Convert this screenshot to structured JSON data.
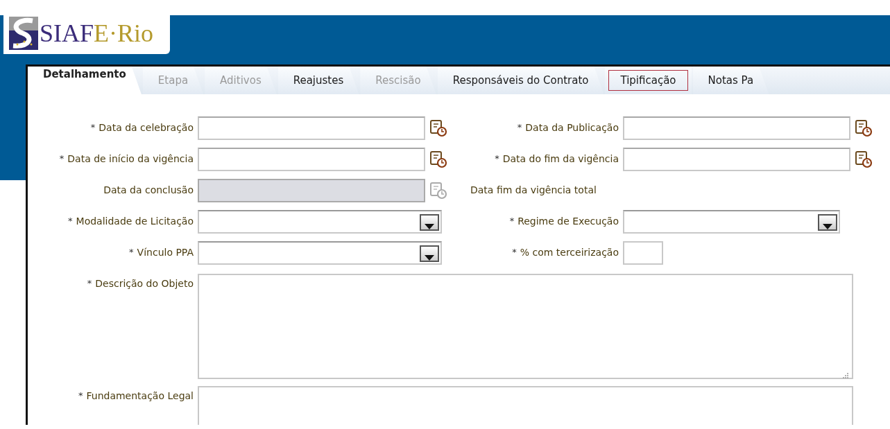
{
  "logo": {
    "text": [
      "SIAF",
      "E·Rio"
    ]
  },
  "tabs": [
    {
      "label": "Detalhamento",
      "selected": true,
      "disabled": false,
      "focused": false
    },
    {
      "label": "Etapa",
      "selected": false,
      "disabled": true,
      "focused": false
    },
    {
      "label": "Aditivos",
      "selected": false,
      "disabled": true,
      "focused": false
    },
    {
      "label": "Reajustes",
      "selected": false,
      "disabled": false,
      "focused": false
    },
    {
      "label": "Rescisão",
      "selected": false,
      "disabled": true,
      "focused": false
    },
    {
      "label": "Responsáveis do Contrato",
      "selected": false,
      "disabled": false,
      "focused": false
    },
    {
      "label": "Tipificação",
      "selected": false,
      "disabled": false,
      "focused": true
    },
    {
      "label": "Notas Pa",
      "selected": false,
      "disabled": false,
      "focused": false
    }
  ],
  "rows": [
    [
      {
        "kind": "date",
        "mark": "*",
        "label": "Data da celebração",
        "disabled": false
      },
      {
        "kind": "date",
        "mark": "*",
        "label": "Data da Publicação",
        "disabled": false
      }
    ],
    [
      {
        "kind": "date",
        "mark": "*",
        "label": "Data de início da vigência",
        "disabled": false
      },
      {
        "kind": "date",
        "mark": "*",
        "label": "Data do fim da vigência",
        "disabled": false
      }
    ],
    [
      {
        "kind": "date",
        "label": "Data da conclusão",
        "disabled": true
      },
      {
        "kind": "text",
        "label": "Data fim da vigência total"
      }
    ],
    [
      {
        "kind": "select",
        "mark": "*",
        "label": "Modalidade de Licitação"
      },
      {
        "kind": "select",
        "mark": "*",
        "label": "Regime de Execução"
      }
    ],
    [
      {
        "kind": "select",
        "mark": "*",
        "label": "Vínculo PPA"
      },
      {
        "kind": "small",
        "mark": "*",
        "label": "% com terceirização"
      }
    ],
    [
      {
        "kind": "area",
        "mark": "*",
        "label": "Descrição do Objeto"
      }
    ],
    [
      {
        "kind": "area-cut",
        "mark": "*",
        "label": "Fundamentação Legal"
      }
    ]
  ]
}
